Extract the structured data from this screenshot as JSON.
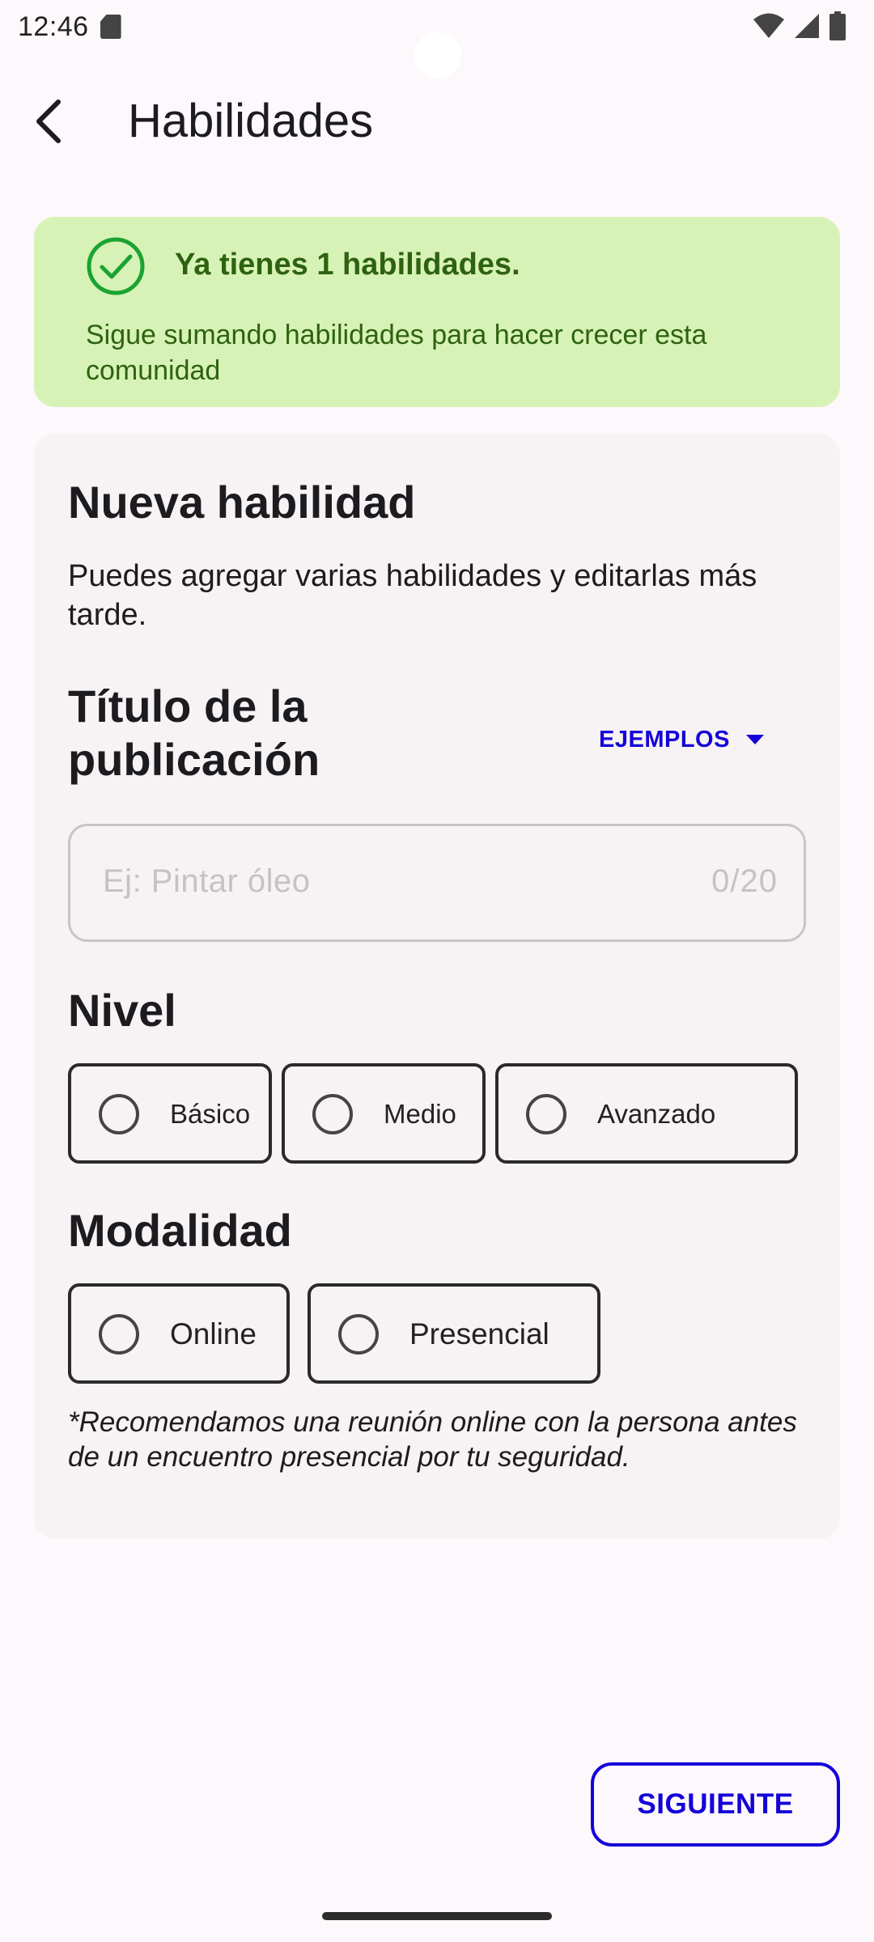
{
  "status_bar": {
    "time": "12:46",
    "icons": [
      "sd-card-icon",
      "wifi-icon",
      "signal-icon",
      "battery-icon"
    ]
  },
  "app_bar": {
    "title": "Habilidades",
    "back_icon": "arrow-back-icon"
  },
  "banner": {
    "icon": "check-circle-icon",
    "title": "Ya tienes 1 habilidades.",
    "text": "Sigue sumando habilidades para hacer crecer esta comunidad",
    "colors": {
      "background": "#d7f2b6",
      "text": "#2e6210",
      "icon": "#1aa331"
    }
  },
  "form": {
    "title": "Nueva habilidad",
    "description": "Puedes agregar varias habilidades y editarlas más tarde.",
    "post_title": {
      "label": "Título de la publicación",
      "examples_label": "EJEMPLOS",
      "placeholder": "Ej: Pintar óleo",
      "value": "",
      "counter": "0/20"
    },
    "level": {
      "label": "Nivel",
      "options": [
        "Básico",
        "Medio",
        "Avanzado"
      ],
      "selected": null
    },
    "modality": {
      "label": "Modalidad",
      "options": [
        "Online",
        "Presencial"
      ],
      "selected": null
    },
    "footnote": "*Recomendamos una reunión online con la persona antes de un encuentro presencial por tu seguridad."
  },
  "actions": {
    "next_label": "SIGUIENTE",
    "accent_color": "#1400d8"
  }
}
